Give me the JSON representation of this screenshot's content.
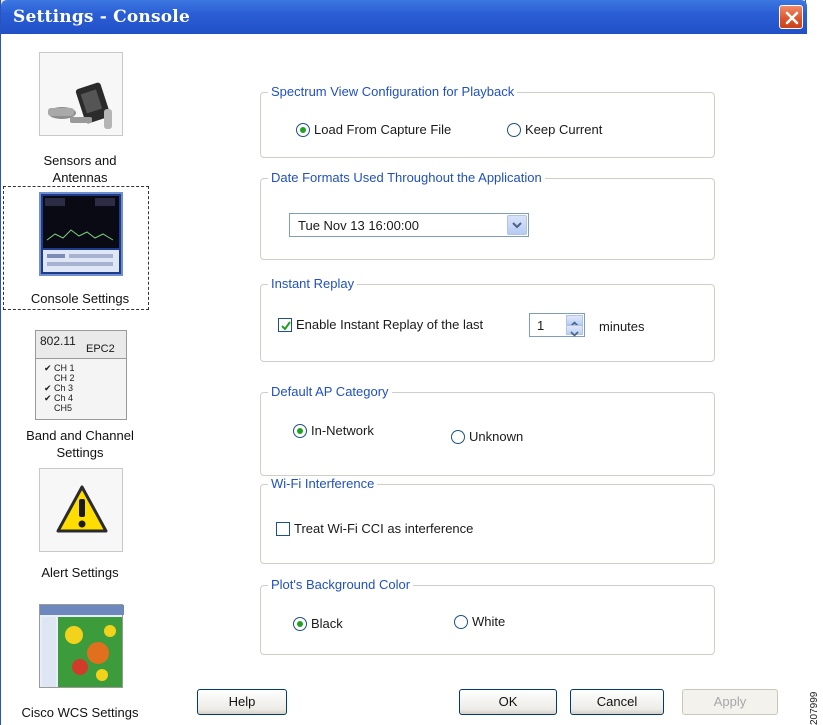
{
  "window": {
    "title": "Settings - Console"
  },
  "sidebar": {
    "items": [
      {
        "label_line1": "Sensors and",
        "label_line2": "Antennas",
        "icon": "sensors-antennas-icon"
      },
      {
        "label_line1": "Console Settings",
        "label_line2": "",
        "icon": "console-settings-icon",
        "selected": true
      },
      {
        "label_line1": "Band and Channel",
        "label_line2": "Settings",
        "icon": "band-channel-icon",
        "thumb_text": {
          "title": "802.11",
          "sub": "EPC2",
          "channels": [
            "CH 1",
            "CH 2",
            "Ch 3",
            "Ch 4",
            "CH5"
          ]
        }
      },
      {
        "label_line1": "Alert Settings",
        "label_line2": "",
        "icon": "alert-warning-icon"
      },
      {
        "label_line1": "Cisco WCS Settings",
        "label_line2": "",
        "icon": "wcs-settings-icon"
      }
    ]
  },
  "groups": {
    "spectrum": {
      "title": "Spectrum View Configuration for Playback",
      "options": [
        "Load From Capture File",
        "Keep Current"
      ],
      "selected": "Load From Capture File"
    },
    "date_formats": {
      "title": "Date Formats Used Throughout the Application",
      "value": "Tue Nov 13 16:00:00"
    },
    "instant_replay": {
      "title": "Instant Replay",
      "checkbox_label": "Enable Instant Replay of the last",
      "checked": true,
      "minutes_value": "1",
      "unit": "minutes"
    },
    "default_ap": {
      "title": "Default AP Category",
      "options": [
        "In-Network",
        "Unknown"
      ],
      "selected": "In-Network"
    },
    "wifi_interference": {
      "title": "Wi-Fi Interference",
      "checkbox_label": "Treat Wi-Fi CCI as interference",
      "checked": false
    },
    "plot_bg": {
      "title": "Plot's Background Color",
      "options": [
        "Black",
        "White"
      ],
      "selected": "Black"
    }
  },
  "buttons": {
    "help": "Help",
    "ok": "OK",
    "cancel": "Cancel",
    "apply": "Apply"
  },
  "figure_number": "207999",
  "colors": {
    "titlebar": "#2b5ed6",
    "group_title": "#2050c0",
    "radio_dot": "#21a121",
    "close": "#d9532b"
  }
}
